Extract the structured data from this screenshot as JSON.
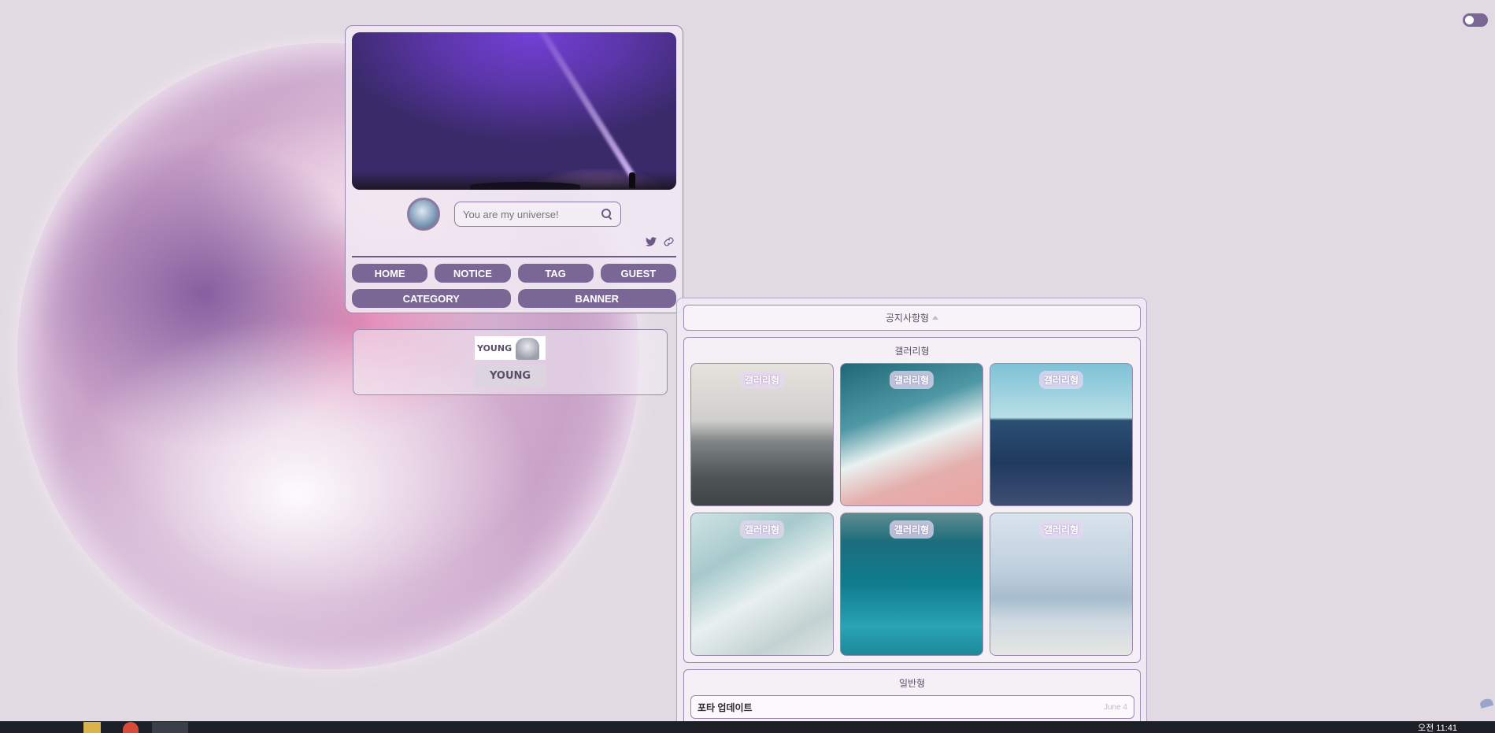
{
  "search": {
    "placeholder": "You are my universe!"
  },
  "nav": {
    "home": "HOME",
    "notice": "NOTICE",
    "tag": "TAG",
    "guest": "GUEST",
    "category": "CATEGORY",
    "banner": "BANNER"
  },
  "banner": {
    "logo_text": "YOUNG",
    "label": "YOUNG"
  },
  "main": {
    "notice_title": "공지사항형",
    "gallery": {
      "title": "갤러리형",
      "items": [
        {
          "tag": "갤러리형"
        },
        {
          "tag": "갤러리형"
        },
        {
          "tag": "갤러리형"
        },
        {
          "tag": "갤러리형"
        },
        {
          "tag": "갤러리형"
        },
        {
          "tag": "갤러리형"
        }
      ]
    },
    "general": {
      "title": "일반형",
      "posts": [
        {
          "title": "포타 업데이트",
          "date": "June 4"
        }
      ]
    }
  },
  "taskbar": {
    "time": "오전 11:41"
  },
  "icons": {
    "search": "search-icon",
    "twitter": "twitter-icon",
    "link": "link-icon",
    "toggle": "theme-toggle"
  },
  "colors": {
    "accent": "#7b6796",
    "background": "#e1dae3",
    "border": "#9b88ad"
  }
}
